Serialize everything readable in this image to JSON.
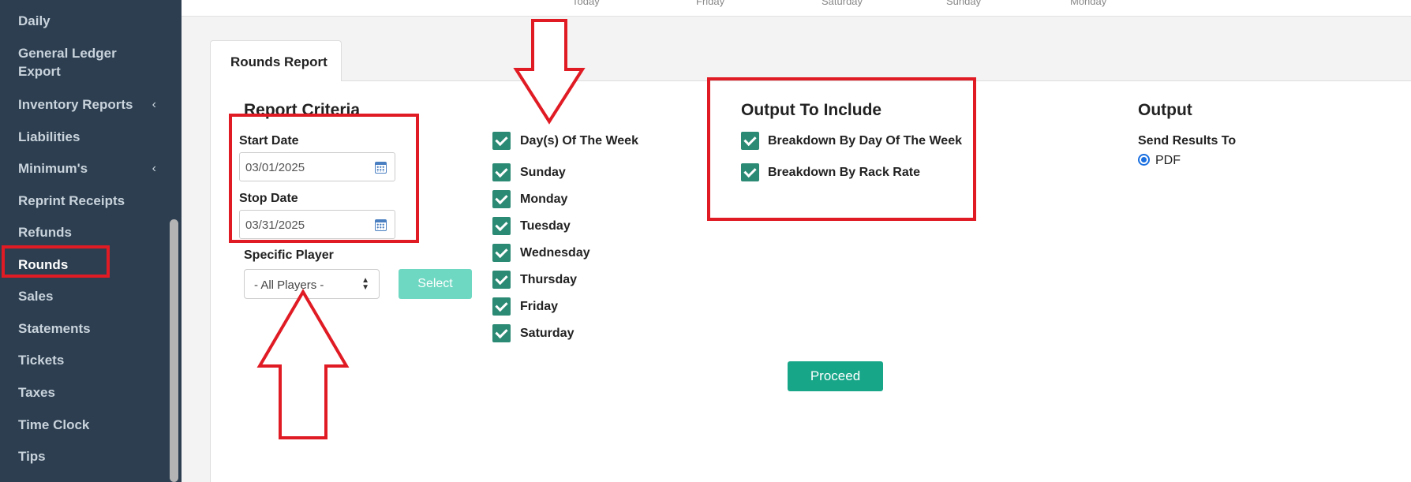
{
  "sidebar": {
    "items": [
      {
        "label": "Daily",
        "chevron": false,
        "active": false
      },
      {
        "label": "General Ledger Export",
        "chevron": false,
        "active": false
      },
      {
        "label": "Inventory Reports",
        "chevron": true,
        "active": false
      },
      {
        "label": "Liabilities",
        "chevron": false,
        "active": false
      },
      {
        "label": "Minimum's",
        "chevron": true,
        "active": false
      },
      {
        "label": "Reprint Receipts",
        "chevron": false,
        "active": false
      },
      {
        "label": "Refunds",
        "chevron": false,
        "active": false
      },
      {
        "label": "Rounds",
        "chevron": false,
        "active": true
      },
      {
        "label": "Sales",
        "chevron": false,
        "active": false
      },
      {
        "label": "Statements",
        "chevron": false,
        "active": false
      },
      {
        "label": "Tickets",
        "chevron": false,
        "active": false
      },
      {
        "label": "Taxes",
        "chevron": false,
        "active": false
      },
      {
        "label": "Time Clock",
        "chevron": false,
        "active": false
      },
      {
        "label": "Tips",
        "chevron": false,
        "active": false
      }
    ],
    "chevron_glyph": "‹"
  },
  "top_strip": {
    "labels": [
      "Today",
      "Friday",
      "Saturday",
      "Sunday",
      "Monday"
    ]
  },
  "tab": {
    "label": "Rounds Report"
  },
  "criteria": {
    "heading": "Report Criteria",
    "start_date_label": "Start Date",
    "start_date_value": "03/01/2025",
    "stop_date_label": "Stop Date",
    "stop_date_value": "03/31/2025",
    "player_label": "Specific Player",
    "player_value": "- All Players -",
    "select_button": "Select"
  },
  "days": {
    "header": "Day(s) Of The Week",
    "items": [
      "Sunday",
      "Monday",
      "Tuesday",
      "Wednesday",
      "Thursday",
      "Friday",
      "Saturday"
    ]
  },
  "output_include": {
    "heading": "Output To Include",
    "options": [
      "Breakdown By Day Of The Week",
      "Breakdown By Rack Rate"
    ]
  },
  "output": {
    "heading": "Output",
    "send_label": "Send Results To",
    "pdf_label": "PDF"
  },
  "proceed_button": "Proceed",
  "colors": {
    "sidebar_bg": "#2c3e50",
    "checkbox": "#2b8a74",
    "proceed": "#18a689",
    "select_btn": "#6fd8c2",
    "annotation_red": "#e01b24"
  }
}
